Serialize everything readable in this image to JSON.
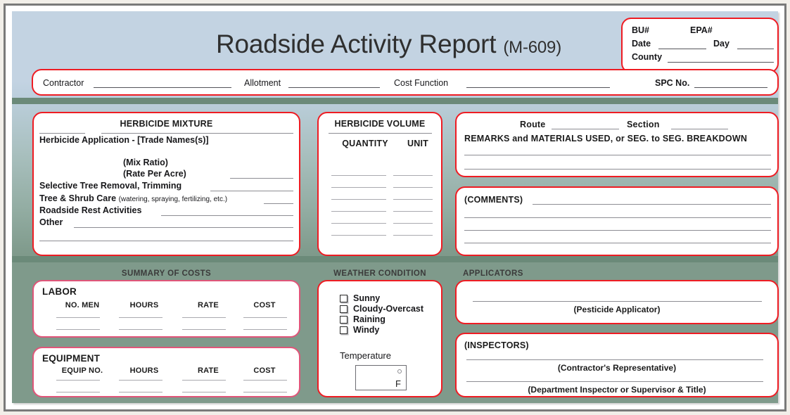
{
  "document": {
    "title": "Roadside Activity Report",
    "form_code": "(M-609)"
  },
  "header_box": {
    "bu_label": "BU#",
    "epa_label": "EPA#",
    "date_label": "Date",
    "day_label": "Day",
    "county_label": "County"
  },
  "contractor_row": {
    "contractor_label": "Contractor",
    "allotment_label": "Allotment",
    "cost_function_label": "Cost Function",
    "spc_label": "SPC No."
  },
  "herbicide_mixture": {
    "title": "HERBICIDE MIXTURE",
    "rows": [
      "Herbicide Application - [Trade Names(s)]",
      "(Mix Ratio)",
      "(Rate Per Acre)",
      "Selective Tree Removal, Trimming",
      "Tree & Shrub Care",
      "Roadside Rest Activities",
      "Other"
    ],
    "tree_shrub_note": "(watering, spraying, fertilizing, etc.)"
  },
  "herbicide_volume": {
    "title": "HERBICIDE VOLUME",
    "columns": [
      "QUANTITY",
      "UNIT"
    ],
    "row_count": 6
  },
  "route_remarks": {
    "route_label": "Route",
    "section_label": "Section",
    "remarks_label": "REMARKS and MATERIALS USED, or SEG. to SEG. BREAKDOWN"
  },
  "comments": {
    "label": "(COMMENTS)"
  },
  "summary_of_costs": {
    "section_header": "SUMMARY OF COSTS",
    "labor": {
      "title": "LABOR",
      "columns": [
        "NO. MEN",
        "HOURS",
        "RATE",
        "COST"
      ],
      "row_count": 2
    },
    "equipment": {
      "title": "EQUIPMENT",
      "columns": [
        "EQUIP NO.",
        "HOURS",
        "RATE",
        "COST"
      ],
      "row_count": 2
    }
  },
  "weather_condition": {
    "section_header": "WEATHER CONDITION",
    "options": [
      "Sunny",
      "Cloudy-Overcast",
      "Raining",
      "Windy"
    ],
    "temperature_label": "Temperature",
    "temperature_value": "",
    "temperature_unit": "F"
  },
  "applicators": {
    "section_header": "APPLICATORS",
    "pesticide_applicator_caption": "(Pesticide Applicator)"
  },
  "inspectors": {
    "label": "(INSPECTORS)",
    "contractor_rep_caption": "(Contractor's Representative)",
    "department_inspector_caption": "(Department Inspector or Supervisor & Title)"
  },
  "colors": {
    "accent_red": "#ee1c23",
    "accent_pink": "#e05579",
    "band_top": "#c3d3e2",
    "band_bottom": "#7f9a8b",
    "separator": "#6b8a79",
    "frame_gray": "#7a7a7a"
  }
}
